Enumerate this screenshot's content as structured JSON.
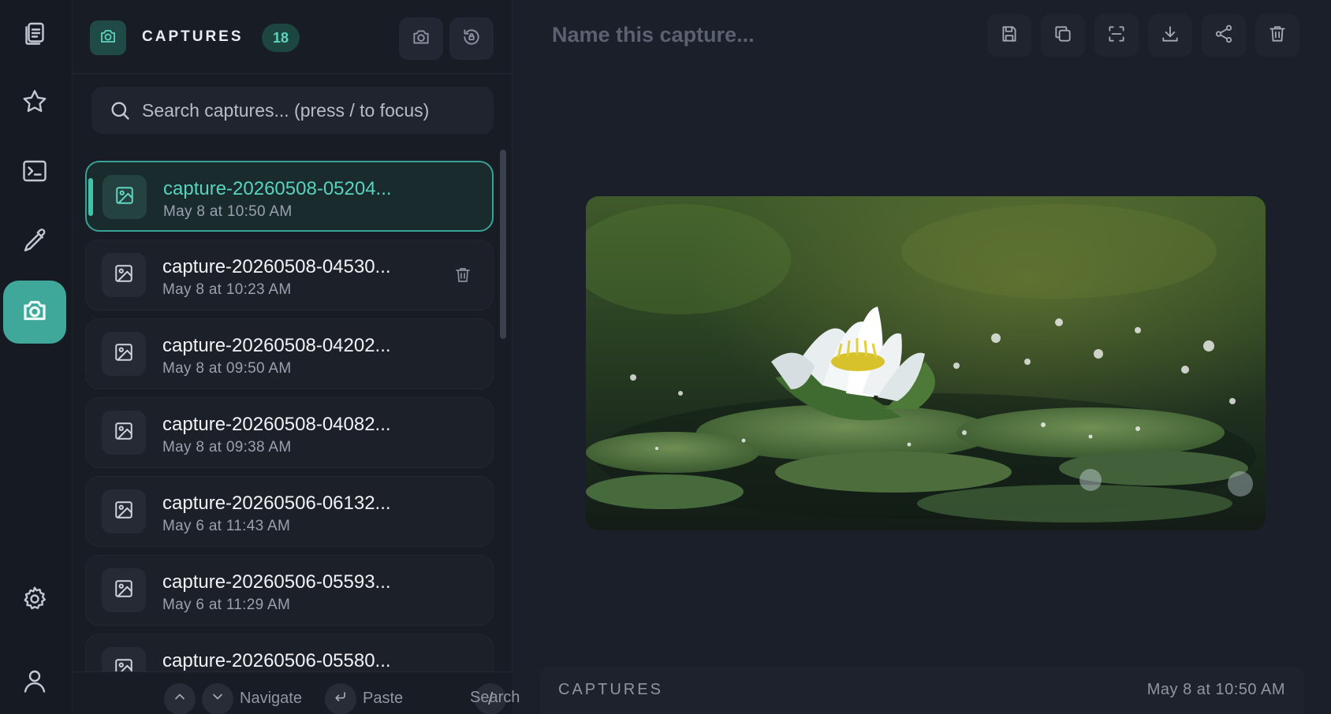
{
  "rail": {
    "items": [
      {
        "icon": "clipboard-icon"
      },
      {
        "icon": "star-icon"
      },
      {
        "icon": "terminal-icon"
      },
      {
        "icon": "eyedropper-icon"
      },
      {
        "icon": "camera-icon",
        "active": true
      },
      {
        "icon": "gear-icon"
      },
      {
        "icon": "user-icon"
      }
    ]
  },
  "sidebar": {
    "title": "CAPTURES",
    "count": "18",
    "search": {
      "placeholder": "Search captures... (press / to focus)",
      "value": ""
    },
    "items": [
      {
        "name": "capture-20260508-05204...",
        "date": "May 8 at 10:50 AM",
        "selected": true
      },
      {
        "name": "capture-20260508-04530...",
        "date": "May 8 at 10:23 AM",
        "hovered": true
      },
      {
        "name": "capture-20260508-04202...",
        "date": "May 8 at 09:50 AM"
      },
      {
        "name": "capture-20260508-04082...",
        "date": "May 8 at 09:38 AM"
      },
      {
        "name": "capture-20260506-06132...",
        "date": "May 6 at 11:43 AM"
      },
      {
        "name": "capture-20260506-05593...",
        "date": "May 6 at 11:29 AM"
      },
      {
        "name": "capture-20260506-05580...",
        "date": ""
      }
    ],
    "footer": {
      "navigate": "Navigate",
      "paste": "Paste",
      "slash_key": "/",
      "search": "Search"
    }
  },
  "main": {
    "name_placeholder": "Name this capture...",
    "name_value": "",
    "toolbar": [
      "save-icon",
      "copy-icon",
      "scan-icon",
      "download-icon",
      "share-icon",
      "trash-icon"
    ],
    "status": {
      "label": "CAPTURES",
      "timestamp": "May 8 at 10:50 AM"
    }
  },
  "colors": {
    "accent": "#3fa89a",
    "accent_text": "#58d3bd",
    "background": "#1b1f29"
  }
}
